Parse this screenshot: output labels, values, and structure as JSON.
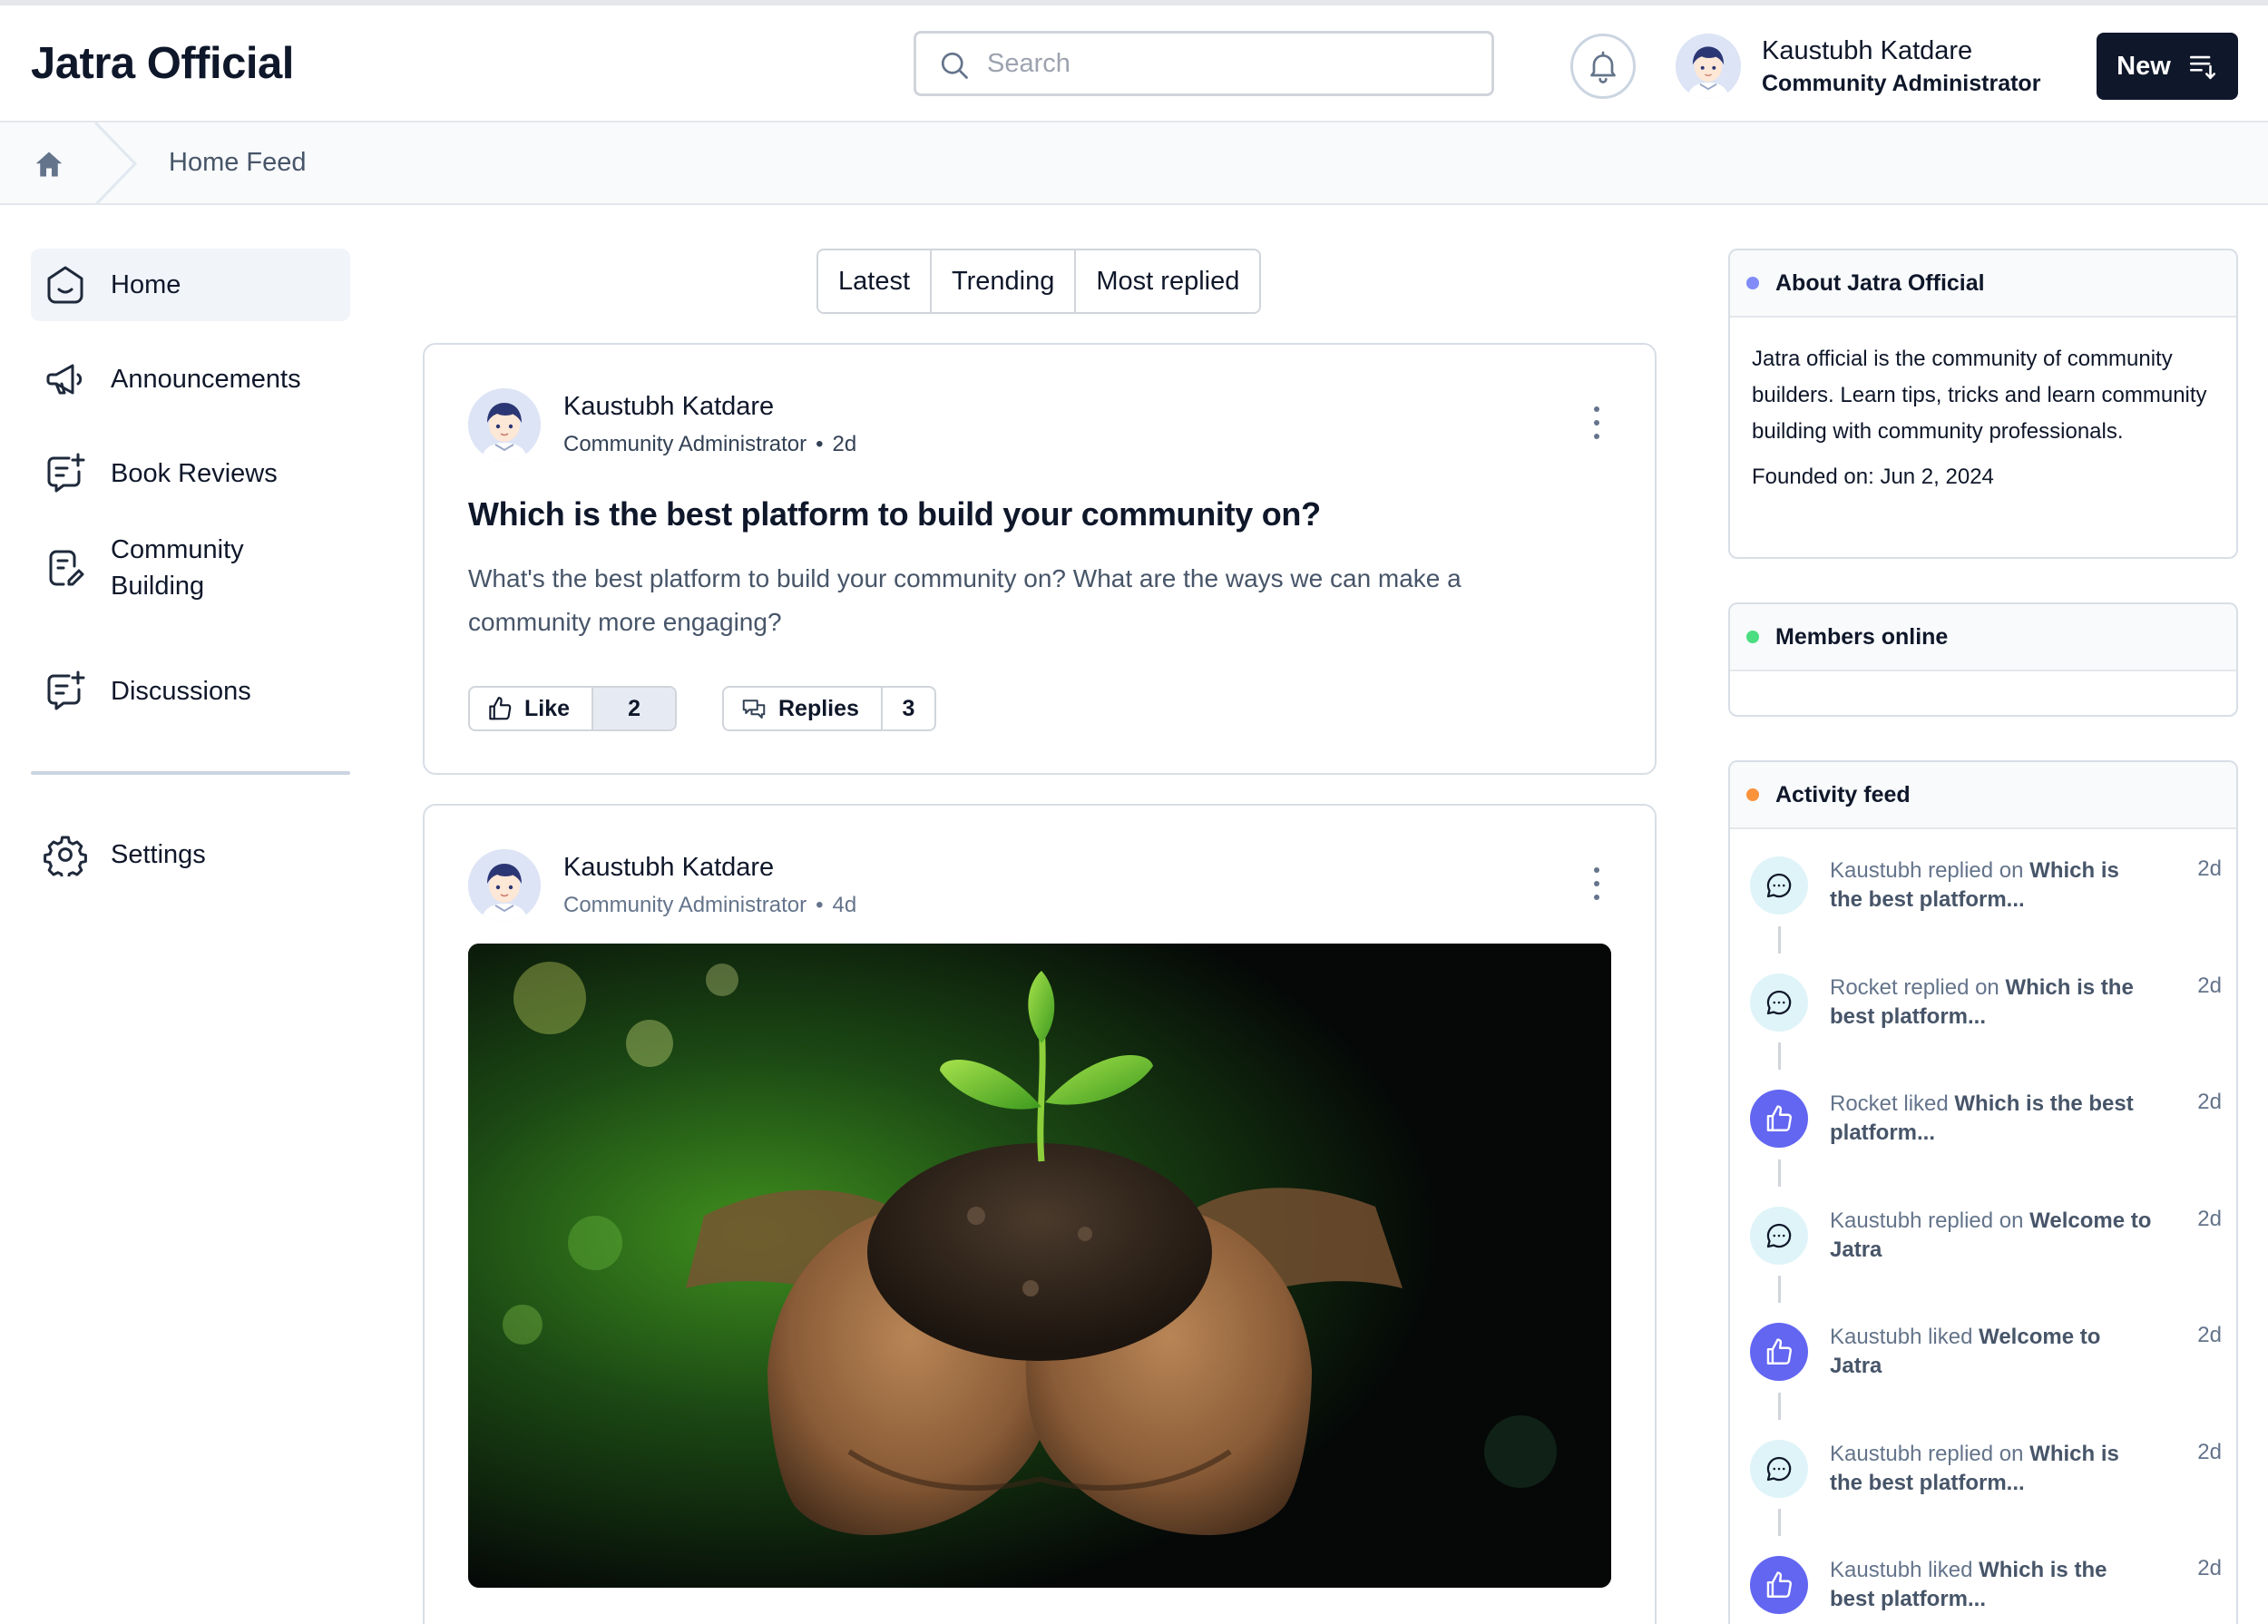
{
  "app": {
    "title": "Jatra Official"
  },
  "search": {
    "placeholder": "Search"
  },
  "user": {
    "name": "Kaustubh Katdare",
    "role": "Community Administrator"
  },
  "header": {
    "new_label": "New"
  },
  "breadcrumb": {
    "current": "Home Feed"
  },
  "sidebar": {
    "items": [
      {
        "label": "Home",
        "icon": "home-icon",
        "active": true
      },
      {
        "label": "Announcements",
        "icon": "megaphone-icon",
        "active": false
      },
      {
        "label": "Book Reviews",
        "icon": "chat-plus-icon",
        "active": false
      },
      {
        "label": "Community Building",
        "icon": "note-edit-icon",
        "active": false
      },
      {
        "label": "Discussions",
        "icon": "chat-plus-icon",
        "active": false
      }
    ],
    "settings": {
      "label": "Settings",
      "icon": "gear-icon"
    }
  },
  "tabs": [
    "Latest",
    "Trending",
    "Most replied"
  ],
  "posts": [
    {
      "author": "Kaustubh Katdare",
      "role": "Community Administrator",
      "separator": "•",
      "time": "2d",
      "title": "Which is the best platform to build your community on?",
      "body": "What's the best platform to build your community on? What are the ways we can make a community more engaging?",
      "like_label": "Like",
      "like_count": "2",
      "replies_label": "Replies",
      "replies_count": "3"
    },
    {
      "author": "Kaustubh Katdare",
      "role": "Community Administrator",
      "separator": "•",
      "time": "4d",
      "image": "hands-holding-seedling-photo"
    }
  ],
  "about": {
    "title": "About Jatra Official",
    "description": "Jatra official is the community of community builders. Learn tips, tricks and learn community building with community professionals.",
    "founded": "Founded on: Jun 2, 2024",
    "dot_color": "#818cf8"
  },
  "members": {
    "title": "Members online",
    "dot_color": "#4ade80"
  },
  "activity": {
    "title": "Activity feed",
    "dot_color": "#fb923c",
    "items": [
      {
        "type": "reply",
        "actor_action": "Kaustubh replied on ",
        "target": "Which is the best platform...",
        "time": "2d"
      },
      {
        "type": "reply",
        "actor_action": "Rocket replied on ",
        "target": "Which is the best platform...",
        "time": "2d"
      },
      {
        "type": "like",
        "actor_action": "Rocket liked ",
        "target": "Which is the best platform...",
        "time": "2d"
      },
      {
        "type": "reply",
        "actor_action": "Kaustubh replied on ",
        "target": "Welcome to Jatra",
        "time": "2d"
      },
      {
        "type": "like",
        "actor_action": "Kaustubh liked ",
        "target": "Welcome to Jatra",
        "time": "2d"
      },
      {
        "type": "reply",
        "actor_action": "Kaustubh replied on ",
        "target": "Which is the best platform...",
        "time": "2d"
      },
      {
        "type": "like",
        "actor_action": "Kaustubh liked ",
        "target": "Which is the best platform...",
        "time": "2d"
      }
    ]
  },
  "colors": {
    "primary": "#0f172a",
    "accent": "#6366f1",
    "reply_bg": "#dff4f8"
  }
}
